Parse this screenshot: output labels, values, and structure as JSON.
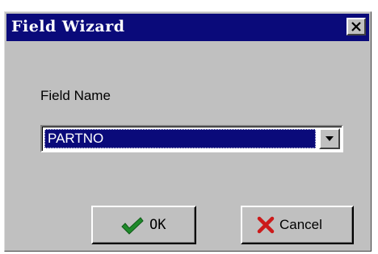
{
  "window": {
    "title": "Field Wizard",
    "close_icon": "close-icon"
  },
  "form": {
    "field_name_label": "Field Name",
    "field_name_value": "PARTNO",
    "dropdown_icon": "chevron-down-icon"
  },
  "buttons": {
    "ok_label": "OK",
    "ok_icon": "checkmark-icon",
    "cancel_label": "Cancel",
    "cancel_icon": "x-icon"
  },
  "colors": {
    "titlebar": "#0a0a7a",
    "face": "#c0c0c0",
    "check_green": "#1f8a2a",
    "cancel_red": "#cc1a1a"
  }
}
